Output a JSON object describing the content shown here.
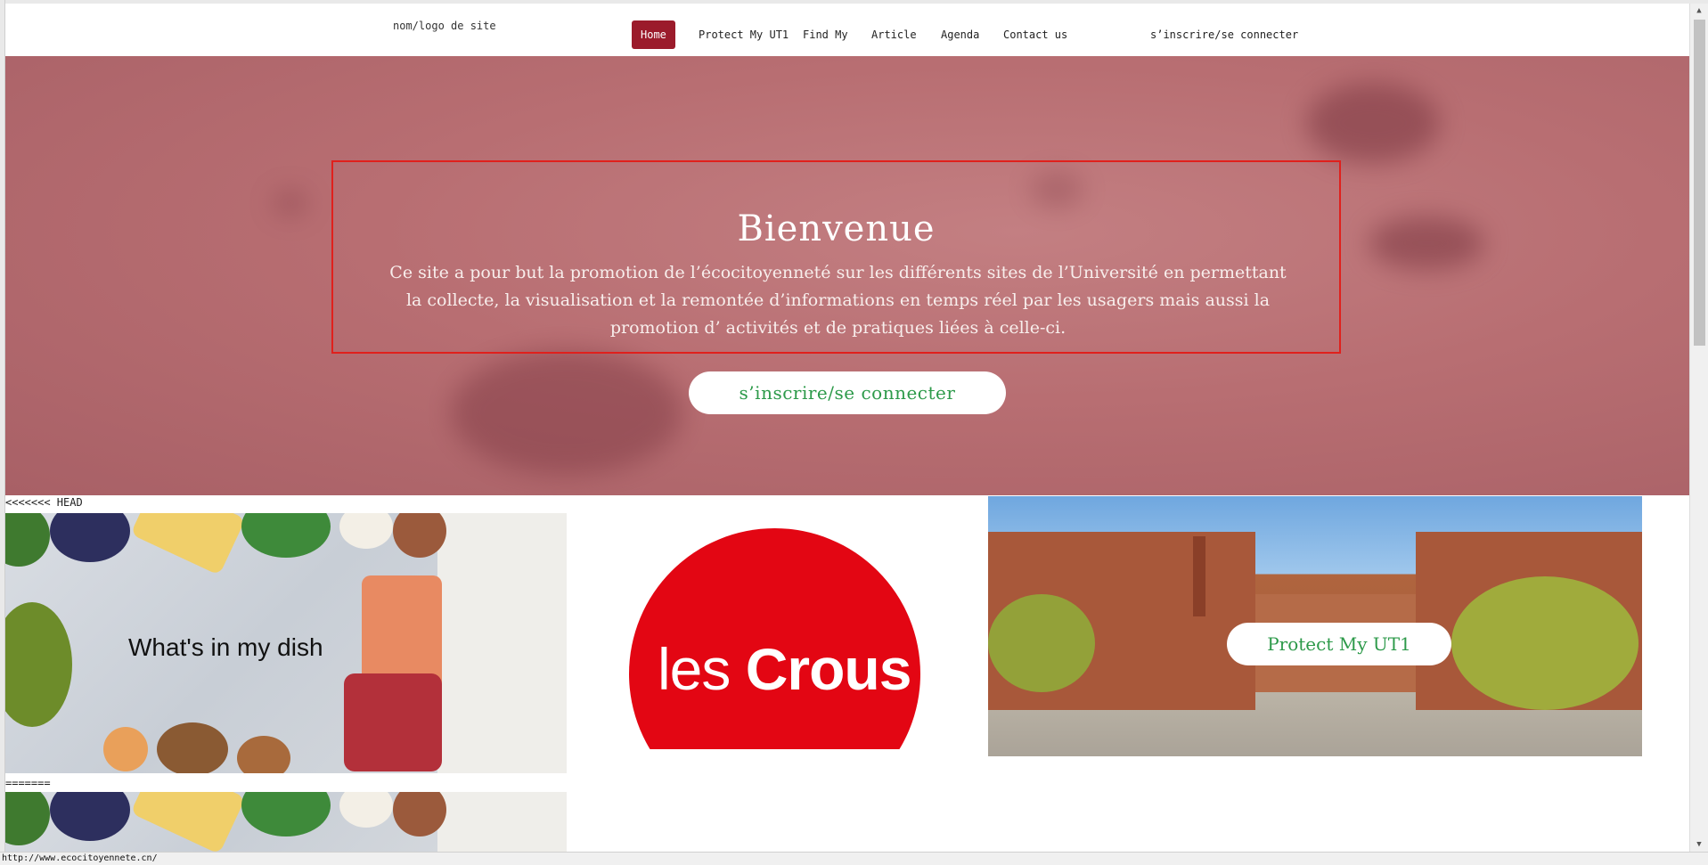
{
  "navbar": {
    "logo": "nom/logo de site",
    "items": [
      {
        "label": "Home",
        "active": true
      },
      {
        "label": "Protect My UT1",
        "active": false
      },
      {
        "label": "Find My",
        "active": false
      },
      {
        "label": "Article",
        "active": false
      },
      {
        "label": "Agenda",
        "active": false
      },
      {
        "label": "Contact us",
        "active": false
      }
    ],
    "login": "s’inscrire/se connecter",
    "active_color": "#9b1b2b"
  },
  "hero": {
    "title": "Bienvenue",
    "text": "Ce site a pour but la promotion de l’écocitoyenneté sur les différents sites de l’Université en permettant la collecte, la visualisation et la remontée d’informations en temps réel par les usagers mais aussi la promotion d’ activités et de pratiques liées à celle-ci.",
    "button": "s’inscrire/se connecter",
    "border_color": "#e0201c",
    "button_text_color": "#2d9a4a"
  },
  "content": {
    "marker_head": "<<<<<<< HEAD",
    "marker_sep": "=======",
    "dish_label": "What's in my dish",
    "crous_light": "les ",
    "crous_bold": "Crous",
    "campus_button": "Protect My UT1"
  },
  "status": {
    "url": "http://www.ecocitoyennete.cn/"
  }
}
